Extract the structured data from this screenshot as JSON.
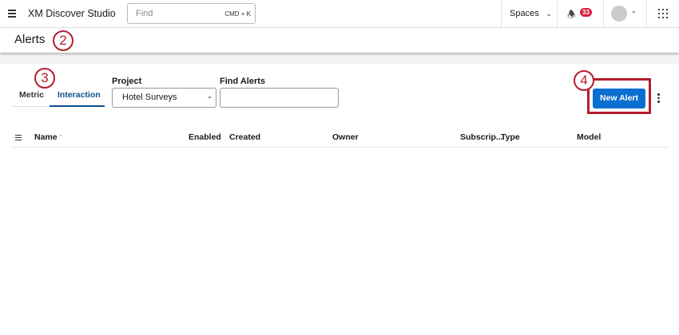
{
  "topbar": {
    "app_title": "XM Discover Studio",
    "search_placeholder": "Find",
    "search_shortcut": "CMD + K",
    "spaces_label": "Spaces",
    "notification_count": "33"
  },
  "page": {
    "title": "Alerts"
  },
  "annotations": [
    "2",
    "3",
    "4"
  ],
  "tabs": [
    {
      "label": "Metric",
      "active": false
    },
    {
      "label": "Interaction",
      "active": true
    }
  ],
  "filters": {
    "project_label": "Project",
    "project_value": "Hotel Surveys",
    "find_label": "Find Alerts",
    "find_value": ""
  },
  "actions": {
    "new_alert": "New Alert"
  },
  "table": {
    "columns": [
      "Name",
      "Enabled",
      "Created",
      "Owner",
      "Subscrip...",
      "Type",
      "Model"
    ],
    "rows": []
  },
  "colors": {
    "accent": "#0b6ed1",
    "annotation": "#b41e2e",
    "badge": "#d61f3c"
  }
}
